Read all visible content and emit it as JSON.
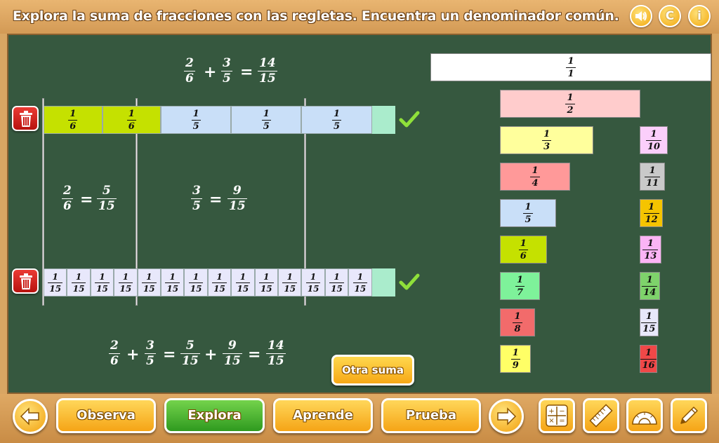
{
  "header": {
    "title": "Explora la suma de fracciones con las regletas. Encuentra un denominador común.",
    "sound_icon": "speaker-icon",
    "credits_label": "C",
    "info_label": "i"
  },
  "equation_top": {
    "a": {
      "n": "2",
      "d": "6"
    },
    "b": {
      "n": "3",
      "d": "5"
    },
    "result": {
      "n": "14",
      "d": "15"
    },
    "plus": "+",
    "equals": "="
  },
  "row1": {
    "cells": [
      {
        "n": "1",
        "d": "6",
        "color": "#c5e100"
      },
      {
        "n": "1",
        "d": "6",
        "color": "#c5e100"
      },
      {
        "n": "1",
        "d": "5",
        "color": "#c9dff8"
      },
      {
        "n": "1",
        "d": "5",
        "color": "#c9dff8"
      },
      {
        "n": "1",
        "d": "5",
        "color": "#c9dff8"
      }
    ],
    "remainder_color": "#aaeccc"
  },
  "row2": {
    "cells": [
      {
        "n": "1",
        "d": "15"
      },
      {
        "n": "1",
        "d": "15"
      },
      {
        "n": "1",
        "d": "15"
      },
      {
        "n": "1",
        "d": "15"
      },
      {
        "n": "1",
        "d": "15"
      },
      {
        "n": "1",
        "d": "15"
      },
      {
        "n": "1",
        "d": "15"
      },
      {
        "n": "1",
        "d": "15"
      },
      {
        "n": "1",
        "d": "15"
      },
      {
        "n": "1",
        "d": "15"
      },
      {
        "n": "1",
        "d": "15"
      },
      {
        "n": "1",
        "d": "15"
      },
      {
        "n": "1",
        "d": "15"
      },
      {
        "n": "1",
        "d": "15"
      }
    ],
    "cell_color": "#e8e8fb",
    "remainder_color": "#aaeccc"
  },
  "equivalences": {
    "left": {
      "a": {
        "n": "2",
        "d": "6"
      },
      "b": {
        "n": "5",
        "d": "15"
      },
      "equals": "="
    },
    "right": {
      "a": {
        "n": "3",
        "d": "5"
      },
      "b": {
        "n": "9",
        "d": "15"
      },
      "equals": "="
    }
  },
  "equation_bottom": {
    "f1": {
      "n": "2",
      "d": "6"
    },
    "f2": {
      "n": "3",
      "d": "5"
    },
    "f3": {
      "n": "5",
      "d": "15"
    },
    "f4": {
      "n": "9",
      "d": "15"
    },
    "f5": {
      "n": "14",
      "d": "15"
    },
    "plus": "+",
    "equals": "="
  },
  "palette": [
    {
      "n": "1",
      "d": "1",
      "color": "#ffffff"
    },
    {
      "n": "1",
      "d": "2",
      "color": "#ffcccc"
    },
    {
      "n": "1",
      "d": "3",
      "color": "#ffff9c"
    },
    {
      "n": "1",
      "d": "4",
      "color": "#ff9999"
    },
    {
      "n": "1",
      "d": "5",
      "color": "#c9dff8"
    },
    {
      "n": "1",
      "d": "6",
      "color": "#c5e100"
    },
    {
      "n": "1",
      "d": "7",
      "color": "#7ef29a"
    },
    {
      "n": "1",
      "d": "8",
      "color": "#f26b6b"
    },
    {
      "n": "1",
      "d": "9",
      "color": "#ffff66"
    },
    {
      "n": "1",
      "d": "10",
      "color": "#fbcffb"
    },
    {
      "n": "1",
      "d": "11",
      "color": "#c9c9c9"
    },
    {
      "n": "1",
      "d": "12",
      "color": "#f5c400"
    },
    {
      "n": "1",
      "d": "13",
      "color": "#fbb4f5"
    },
    {
      "n": "1",
      "d": "14",
      "color": "#7ed36b"
    },
    {
      "n": "1",
      "d": "15",
      "color": "#e8e8fb"
    },
    {
      "n": "1",
      "d": "16",
      "color": "#f04848"
    }
  ],
  "otra_suma_label": "Otra suma",
  "footer": {
    "observa": "Observa",
    "explora": "Explora",
    "aprende": "Aprende",
    "prueba": "Prueba",
    "back_icon": "arrow-left-icon",
    "next_icon": "arrow-right-icon",
    "tools": [
      "calculator-icon",
      "ruler-icon",
      "protractor-icon",
      "pencil-icon"
    ]
  }
}
